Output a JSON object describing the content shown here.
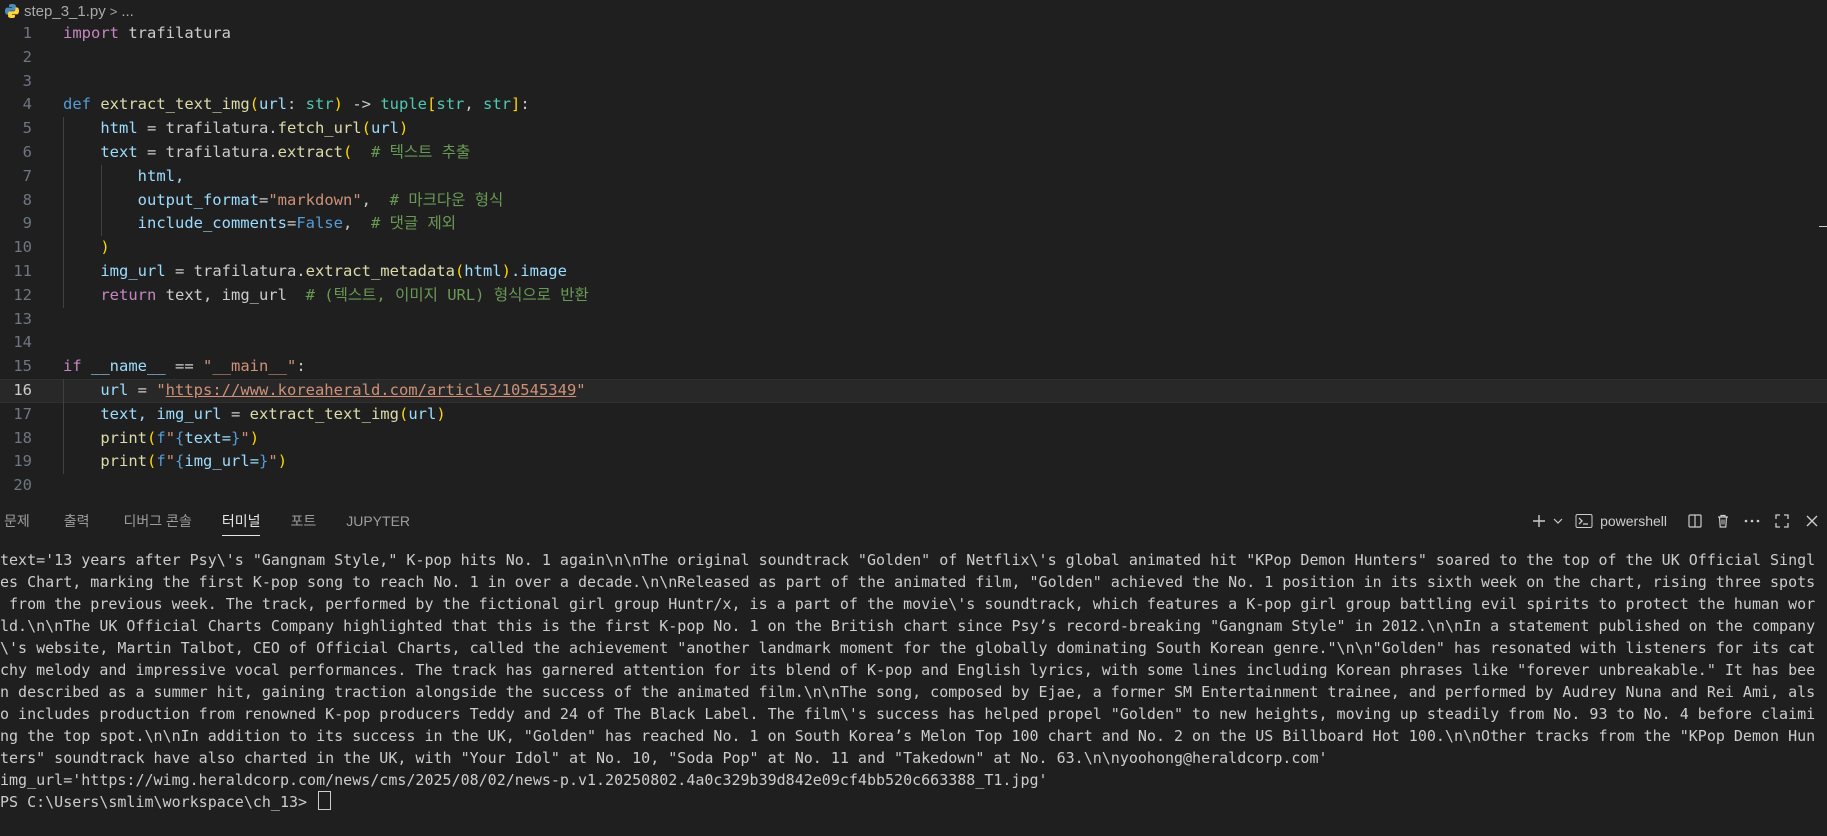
{
  "breadcrumb": {
    "file": "step_3_1.py",
    "sep": ">",
    "more": "..."
  },
  "editor": {
    "line_numbers": [
      "1",
      "2",
      "3",
      "4",
      "5",
      "6",
      "7",
      "8",
      "9",
      "10",
      "11",
      "12",
      "13",
      "14",
      "15",
      "16",
      "17",
      "18",
      "19",
      "20"
    ],
    "current_line": 16,
    "code": {
      "import_kw": "import",
      "import_mod": " trafilatura",
      "def_kw": "def",
      "fn_name": "extract_text_img",
      "param": "url",
      "colon_str": ": ",
      "str_t": "str",
      "arrow": " -> ",
      "tuple_t": "tuple",
      "str_t2": "str",
      "comma": ", ",
      "str_t3": "str",
      "def_end": ":",
      "l5_var": "html",
      "l5_eq": " = trafilatura.",
      "l5_fn": "fetch_url",
      "l5_arg": "url",
      "l6_var": "text",
      "l6_eq": " = trafilatura.",
      "l6_fn": "extract",
      "l6_comment": "# 텍스트 추출",
      "l7": "html,",
      "l8_param": "output_format",
      "l8_eq": "=",
      "l8_val": "\"markdown\"",
      "l8_comma": ",  ",
      "l8_comment": "# 마크다운 형식",
      "l9_param": "include_comments",
      "l9_eq": "=",
      "l9_val": "False",
      "l9_comma": ",  ",
      "l9_comment": "# 댓글 제외",
      "l10": ")",
      "l11_var": "img_url",
      "l11_eq": " = trafilatura.",
      "l11_fn": "extract_metadata",
      "l11_arg": "html",
      "l11_attr": ".image",
      "l12_kw": "return",
      "l12_rest": " text, img_url  ",
      "l12_comment": "# (텍스트, 이미지 URL) 형식으로 반환",
      "l15_kw": "if",
      "l15_name": " __name__",
      "l15_eq": " == ",
      "l15_str": "\"__main__\"",
      "l15_colon": ":",
      "l16_var": "url",
      "l16_eq": " = ",
      "l16_q1": "\"",
      "l16_url": "https://www.koreaherald.com/article/10545349",
      "l16_q2": "\"",
      "l17_a": "text, img_url",
      "l17_eq": " = ",
      "l17_fn": "extract_text_img",
      "l17_arg": "url",
      "l18_fn": "print",
      "l18_f": "f\"",
      "l18_expr": "text=",
      "l18_end": "\"",
      "l19_fn": "print",
      "l19_f": "f\"",
      "l19_expr": "img_url=",
      "l19_end": "\""
    }
  },
  "panel": {
    "tabs": [
      "문제",
      "출력",
      "디버그 콘솔",
      "터미널",
      "포트",
      "JUPYTER"
    ],
    "active_tab": "터미널",
    "shell": "powershell"
  },
  "terminal": {
    "lines": [
      "text='13 years after Psy\\'s \"Gangnam Style,\" K-pop hits No. 1 again\\n\\nThe original soundtrack \"Golden\" of Netflix\\'s global animated hit \"KPop Demon Hunters\" soared to the top of the UK Official Singl",
      "es Chart, marking the first K-pop song to reach No. 1 in over a decade.\\n\\nReleased as part of the animated film, \"Golden\" achieved the No. 1 position in its sixth week on the chart, rising three spots",
      " from the previous week. The track, performed by the fictional girl group Huntr/x, is a part of the movie\\'s soundtrack, which features a K-pop girl group battling evil spirits to protect the human wor",
      "ld.\\n\\nThe UK Official Charts Company highlighted that this is the first K-pop No. 1 on the British chart since Psy’s record-breaking \"Gangnam Style\" in 2012.\\n\\nIn a statement published on the company",
      "\\'s website, Martin Talbot, CEO of Official Charts, called the achievement \"another landmark moment for the globally dominating South Korean genre.\"\\n\\n\"Golden\" has resonated with listeners for its cat",
      "chy melody and impressive vocal performances. The track has garnered attention for its blend of K-pop and English lyrics, with some lines including Korean phrases like \"forever unbreakable.\" It has bee",
      "n described as a summer hit, gaining traction alongside the success of the animated film.\\n\\nThe song, composed by Ejae, a former SM Entertainment trainee, and performed by Audrey Nuna and Rei Ami, als",
      "o includes production from renowned K-pop producers Teddy and 24 of The Black Label. The film\\'s success has helped propel \"Golden\" to new heights, moving up steadily from No. 93 to No. 4 before claimi",
      "ng the top spot.\\n\\nIn addition to its success in the UK, \"Golden\" has reached No. 1 on South Korea’s Melon Top 100 chart and No. 2 on the US Billboard Hot 100.\\n\\nOther tracks from the \"KPop Demon Hun",
      "ters\" soundtrack have also charted in the UK, with \"Your Idol\" at No. 10, \"Soda Pop\" at No. 11 and \"Takedown\" at No. 63.\\n\\nyoohong@heraldcorp.com'",
      "img_url='https://wimg.heraldcorp.com/news/cms/2025/08/02/news-p.v1.20250802.4a0c329b39d842e09cf4bb520c663388_T1.jpg'"
    ],
    "prompt": "PS C:\\Users\\smlim\\workspace\\ch_13> "
  },
  "colors": {
    "background": "#1f1f1f",
    "keyword": "#569cd6",
    "string": "#ce9178",
    "comment": "#6a9955",
    "function": "#dcdcaa"
  }
}
